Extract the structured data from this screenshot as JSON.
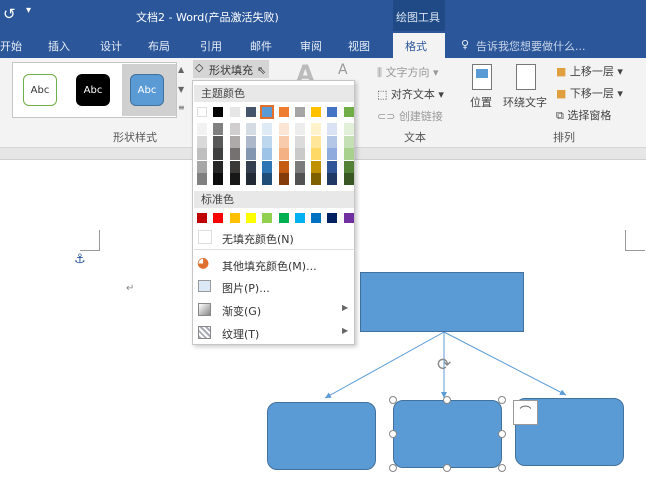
{
  "titlebar": {
    "undo_icon": "redo-icon",
    "qat_icon": "customize-qat-icon",
    "title": "文档2 - Word(产品激活失败)",
    "context_tab": "绘图工具"
  },
  "tabs": [
    "开始",
    "插入",
    "设计",
    "布局",
    "引用",
    "邮件",
    "审阅",
    "视图",
    "格式"
  ],
  "active_tab": "格式",
  "tell_me": "告诉我您想要做什么...",
  "ribbon": {
    "shape_styles": {
      "samples": [
        "Abc",
        "Abc",
        "Abc"
      ],
      "label": "形状样式"
    },
    "shape_fill": "形状填充",
    "wordart": {
      "a1": "A",
      "a2": "A"
    },
    "text_group": {
      "direction": "文字方向",
      "align": "对齐文本",
      "link": "创建链接",
      "label": "文本"
    },
    "arrange": {
      "position": "位置",
      "wrap": "环绕文字",
      "forward": "上移一层",
      "backward": "下移一层",
      "pane": "选择窗格",
      "label": "排列"
    }
  },
  "fill_menu": {
    "theme_header": "主题颜色",
    "theme_colors": [
      "#ffffff",
      "#000000",
      "#e7e6e6",
      "#44546a",
      "#5b9bd5",
      "#ed7d31",
      "#a5a5a5",
      "#ffc000",
      "#4472c4",
      "#70ad47"
    ],
    "selected_theme_color": "#5b9bd5",
    "shades": [
      [
        "#f2f2f2",
        "#d9d9d9",
        "#bfbfbf",
        "#a6a6a6",
        "#808080"
      ],
      [
        "#808080",
        "#595959",
        "#404040",
        "#262626",
        "#0d0d0d"
      ],
      [
        "#d0cece",
        "#aeaaaa",
        "#767171",
        "#3b3838",
        "#181717"
      ],
      [
        "#d6dce4",
        "#adb9ca",
        "#8497b0",
        "#333f4f",
        "#222a35"
      ],
      [
        "#deebf6",
        "#bdd7ee",
        "#9dc3e6",
        "#2e75b5",
        "#1f4e79"
      ],
      [
        "#fbe5d5",
        "#f7cbac",
        "#f4b183",
        "#c55a11",
        "#843c0b"
      ],
      [
        "#ededed",
        "#dbdbdb",
        "#c9c9c9",
        "#7b7b7b",
        "#525252"
      ],
      [
        "#fff2cc",
        "#ffe699",
        "#ffd966",
        "#bf9000",
        "#7f6000"
      ],
      [
        "#dae3f3",
        "#b4c7e7",
        "#8faadc",
        "#2f5597",
        "#203864"
      ],
      [
        "#e2f0d9",
        "#c5e0b4",
        "#a9d18e",
        "#538135",
        "#385723"
      ]
    ],
    "standard_header": "标准色",
    "standard_colors": [
      "#c00000",
      "#ff0000",
      "#ffc000",
      "#ffff00",
      "#92d050",
      "#00b050",
      "#00b0f0",
      "#0070c0",
      "#002060",
      "#7030a0"
    ],
    "no_fill": "无填充颜色(N)",
    "more_colors": "其他填充颜色(M)...",
    "picture": "图片(P)...",
    "gradient": "渐变(G)",
    "texture": "纹理(T)"
  },
  "colors": {
    "brand": "#2b579a",
    "shape_fill": "#5b9bd5",
    "shape_border": "#41719c"
  }
}
